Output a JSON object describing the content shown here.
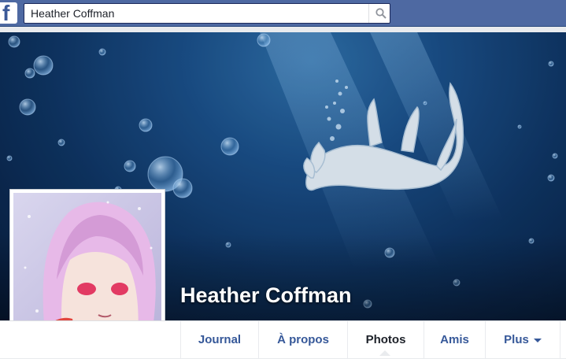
{
  "topbar": {
    "logo_icon": "facebook-f-icon",
    "search_value": "Heather Coffman",
    "search_icon": "search-icon"
  },
  "profile": {
    "name": "Heather Coffman"
  },
  "nav": {
    "items": [
      {
        "label": "Journal"
      },
      {
        "label": "À propos"
      },
      {
        "label": "Photos",
        "active": true
      },
      {
        "label": "Amis"
      },
      {
        "label": "Plus"
      }
    ]
  },
  "colors": {
    "topbar": "#4e69a2",
    "link": "#365899",
    "cover_deep": "#071a38"
  }
}
